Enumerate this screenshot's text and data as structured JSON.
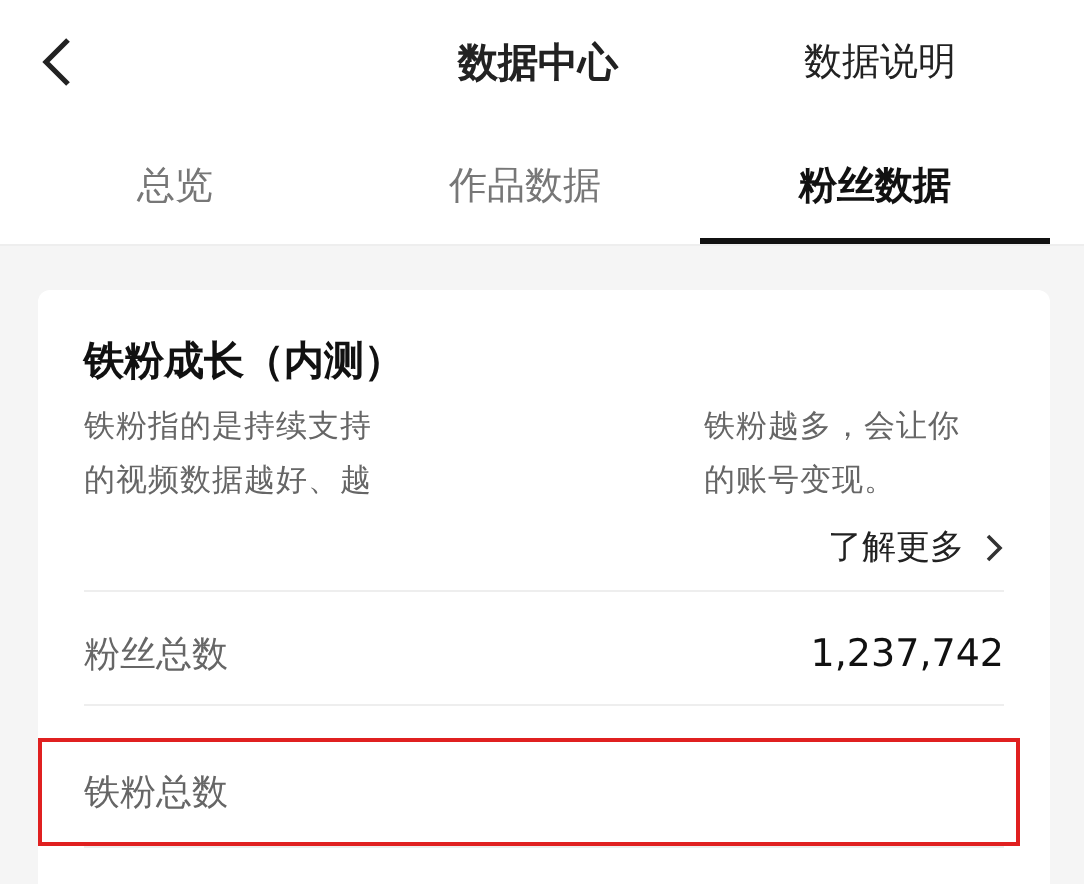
{
  "nav": {
    "title": "数据中心",
    "help": "数据说明"
  },
  "tabs": [
    {
      "label": "总览",
      "selected": false
    },
    {
      "label": "作品数据",
      "selected": false
    },
    {
      "label": "粉丝数据",
      "selected": true
    }
  ],
  "card": {
    "title": "铁粉成长（内测）",
    "description_lines": [
      [
        "铁粉指的是持续支持",
        "铁粉越多，会让你"
      ],
      [
        "的视频数据越好、越",
        "的账号变现。"
      ]
    ],
    "more_link": "了解更多",
    "rows": [
      {
        "label": "粉丝总数",
        "value": "1,237,742",
        "highlighted": false
      },
      {
        "label": "铁粉总数",
        "highlighted": true
      }
    ]
  }
}
